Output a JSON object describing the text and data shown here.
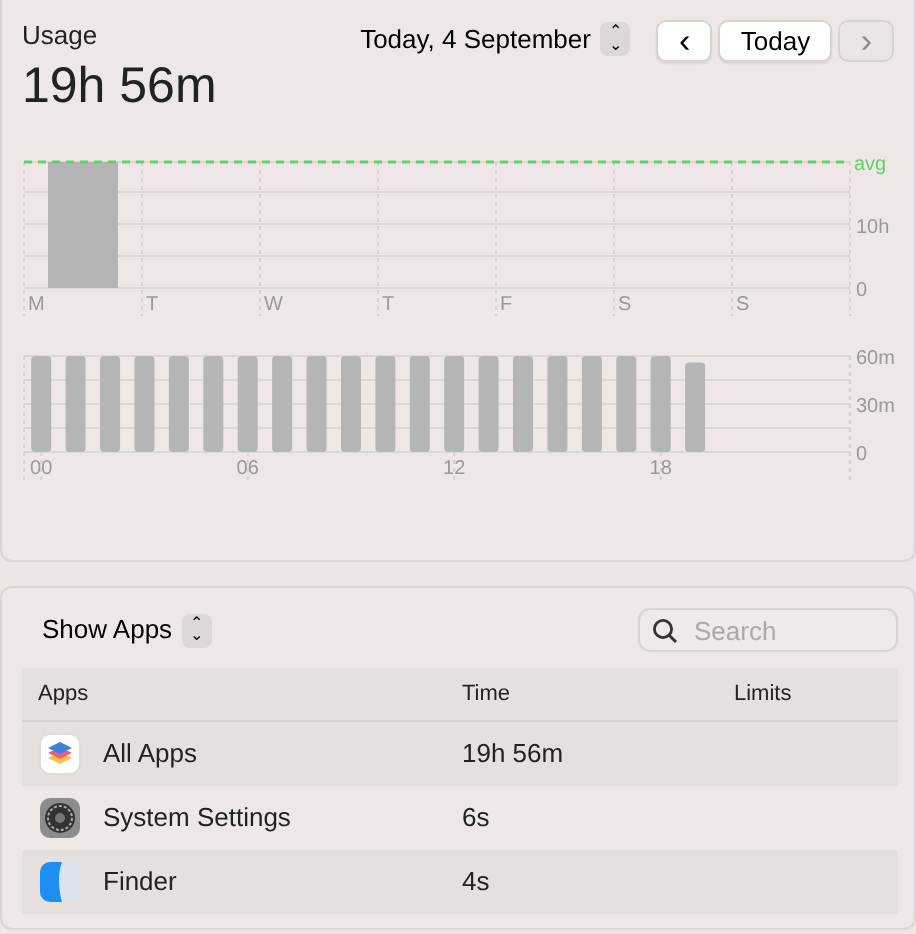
{
  "usage": {
    "label": "Usage",
    "total": "19h 56m"
  },
  "date_picker": {
    "value": "Today, 4 September",
    "stepper": "⌃⌄"
  },
  "nav": {
    "prev": {
      "label": "‹",
      "disabled": false
    },
    "today": {
      "label": "Today"
    },
    "next": {
      "label": "›",
      "disabled": true
    }
  },
  "weekly_chart": {
    "chart_data": {
      "type": "bar",
      "categories": [
        "M",
        "T",
        "W",
        "T",
        "F",
        "S",
        "S"
      ],
      "values": [
        19.9,
        null,
        null,
        null,
        null,
        null,
        null
      ],
      "ylim": [
        0,
        19.9
      ],
      "yticks": [
        {
          "value": 0,
          "label": "0"
        },
        {
          "value": 10,
          "label": "10h"
        }
      ],
      "grid": true,
      "ref_lines": [
        {
          "label": "avg",
          "color": "#5dd36b"
        }
      ]
    }
  },
  "hourly_chart": {
    "chart_data": {
      "type": "bar",
      "x": [
        0,
        1,
        2,
        3,
        4,
        5,
        6,
        7,
        8,
        9,
        10,
        11,
        12,
        13,
        14,
        15,
        16,
        17,
        18,
        19
      ],
      "values": [
        60,
        60,
        60,
        60,
        60,
        60,
        60,
        60,
        60,
        60,
        60,
        60,
        60,
        60,
        60,
        60,
        60,
        60,
        60,
        56
      ],
      "grid": true,
      "xlim": [
        -0.5,
        23.5
      ],
      "ylim": [
        0,
        60
      ],
      "xticks": [
        {
          "value": 0,
          "label": "00"
        },
        {
          "value": 6,
          "label": "06"
        },
        {
          "value": 12,
          "label": "12"
        },
        {
          "value": 18,
          "label": "18"
        }
      ],
      "yticks": [
        {
          "value": 0,
          "label": "0"
        },
        {
          "value": 30,
          "label": "30m"
        },
        {
          "value": 60,
          "label": "60m"
        }
      ]
    }
  },
  "filter": {
    "label": "Show Apps"
  },
  "search": {
    "placeholder": "Search"
  },
  "table": {
    "columns": [
      "Apps",
      "Time",
      "Limits"
    ],
    "rows": [
      {
        "kind": "stack",
        "name": "All Apps",
        "time": "19h 56m"
      },
      {
        "kind": "gear",
        "name": "System Settings",
        "time": "6s"
      },
      {
        "kind": "split",
        "name": "Finder",
        "time": "4s"
      }
    ]
  }
}
